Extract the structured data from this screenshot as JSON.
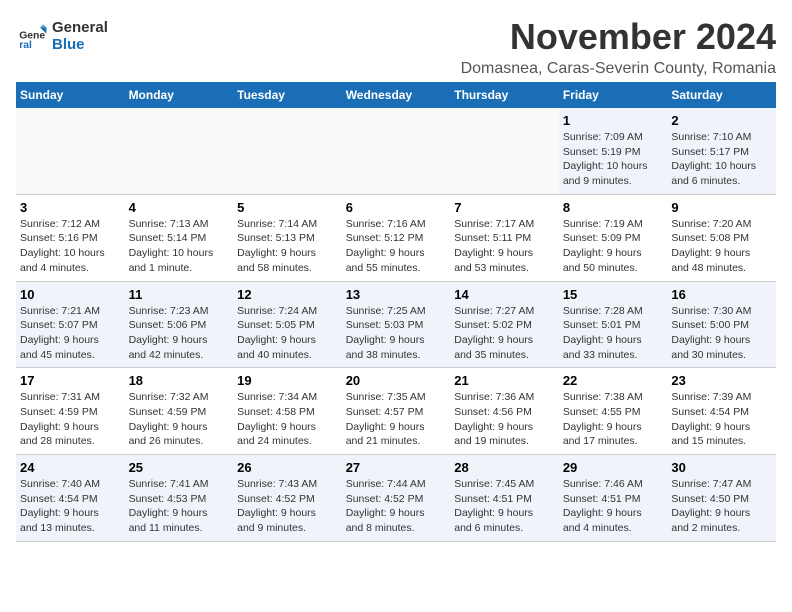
{
  "logo": {
    "text1": "General",
    "text2": "Blue"
  },
  "title": "November 2024",
  "location": "Domasnea, Caras-Severin County, Romania",
  "weekdays": [
    "Sunday",
    "Monday",
    "Tuesday",
    "Wednesday",
    "Thursday",
    "Friday",
    "Saturday"
  ],
  "weeks": [
    [
      {
        "day": "",
        "info": ""
      },
      {
        "day": "",
        "info": ""
      },
      {
        "day": "",
        "info": ""
      },
      {
        "day": "",
        "info": ""
      },
      {
        "day": "",
        "info": ""
      },
      {
        "day": "1",
        "info": "Sunrise: 7:09 AM\nSunset: 5:19 PM\nDaylight: 10 hours\nand 9 minutes."
      },
      {
        "day": "2",
        "info": "Sunrise: 7:10 AM\nSunset: 5:17 PM\nDaylight: 10 hours\nand 6 minutes."
      }
    ],
    [
      {
        "day": "3",
        "info": "Sunrise: 7:12 AM\nSunset: 5:16 PM\nDaylight: 10 hours\nand 4 minutes."
      },
      {
        "day": "4",
        "info": "Sunrise: 7:13 AM\nSunset: 5:14 PM\nDaylight: 10 hours\nand 1 minute."
      },
      {
        "day": "5",
        "info": "Sunrise: 7:14 AM\nSunset: 5:13 PM\nDaylight: 9 hours\nand 58 minutes."
      },
      {
        "day": "6",
        "info": "Sunrise: 7:16 AM\nSunset: 5:12 PM\nDaylight: 9 hours\nand 55 minutes."
      },
      {
        "day": "7",
        "info": "Sunrise: 7:17 AM\nSunset: 5:11 PM\nDaylight: 9 hours\nand 53 minutes."
      },
      {
        "day": "8",
        "info": "Sunrise: 7:19 AM\nSunset: 5:09 PM\nDaylight: 9 hours\nand 50 minutes."
      },
      {
        "day": "9",
        "info": "Sunrise: 7:20 AM\nSunset: 5:08 PM\nDaylight: 9 hours\nand 48 minutes."
      }
    ],
    [
      {
        "day": "10",
        "info": "Sunrise: 7:21 AM\nSunset: 5:07 PM\nDaylight: 9 hours\nand 45 minutes."
      },
      {
        "day": "11",
        "info": "Sunrise: 7:23 AM\nSunset: 5:06 PM\nDaylight: 9 hours\nand 42 minutes."
      },
      {
        "day": "12",
        "info": "Sunrise: 7:24 AM\nSunset: 5:05 PM\nDaylight: 9 hours\nand 40 minutes."
      },
      {
        "day": "13",
        "info": "Sunrise: 7:25 AM\nSunset: 5:03 PM\nDaylight: 9 hours\nand 38 minutes."
      },
      {
        "day": "14",
        "info": "Sunrise: 7:27 AM\nSunset: 5:02 PM\nDaylight: 9 hours\nand 35 minutes."
      },
      {
        "day": "15",
        "info": "Sunrise: 7:28 AM\nSunset: 5:01 PM\nDaylight: 9 hours\nand 33 minutes."
      },
      {
        "day": "16",
        "info": "Sunrise: 7:30 AM\nSunset: 5:00 PM\nDaylight: 9 hours\nand 30 minutes."
      }
    ],
    [
      {
        "day": "17",
        "info": "Sunrise: 7:31 AM\nSunset: 4:59 PM\nDaylight: 9 hours\nand 28 minutes."
      },
      {
        "day": "18",
        "info": "Sunrise: 7:32 AM\nSunset: 4:59 PM\nDaylight: 9 hours\nand 26 minutes."
      },
      {
        "day": "19",
        "info": "Sunrise: 7:34 AM\nSunset: 4:58 PM\nDaylight: 9 hours\nand 24 minutes."
      },
      {
        "day": "20",
        "info": "Sunrise: 7:35 AM\nSunset: 4:57 PM\nDaylight: 9 hours\nand 21 minutes."
      },
      {
        "day": "21",
        "info": "Sunrise: 7:36 AM\nSunset: 4:56 PM\nDaylight: 9 hours\nand 19 minutes."
      },
      {
        "day": "22",
        "info": "Sunrise: 7:38 AM\nSunset: 4:55 PM\nDaylight: 9 hours\nand 17 minutes."
      },
      {
        "day": "23",
        "info": "Sunrise: 7:39 AM\nSunset: 4:54 PM\nDaylight: 9 hours\nand 15 minutes."
      }
    ],
    [
      {
        "day": "24",
        "info": "Sunrise: 7:40 AM\nSunset: 4:54 PM\nDaylight: 9 hours\nand 13 minutes."
      },
      {
        "day": "25",
        "info": "Sunrise: 7:41 AM\nSunset: 4:53 PM\nDaylight: 9 hours\nand 11 minutes."
      },
      {
        "day": "26",
        "info": "Sunrise: 7:43 AM\nSunset: 4:52 PM\nDaylight: 9 hours\nand 9 minutes."
      },
      {
        "day": "27",
        "info": "Sunrise: 7:44 AM\nSunset: 4:52 PM\nDaylight: 9 hours\nand 8 minutes."
      },
      {
        "day": "28",
        "info": "Sunrise: 7:45 AM\nSunset: 4:51 PM\nDaylight: 9 hours\nand 6 minutes."
      },
      {
        "day": "29",
        "info": "Sunrise: 7:46 AM\nSunset: 4:51 PM\nDaylight: 9 hours\nand 4 minutes."
      },
      {
        "day": "30",
        "info": "Sunrise: 7:47 AM\nSunset: 4:50 PM\nDaylight: 9 hours\nand 2 minutes."
      }
    ]
  ]
}
